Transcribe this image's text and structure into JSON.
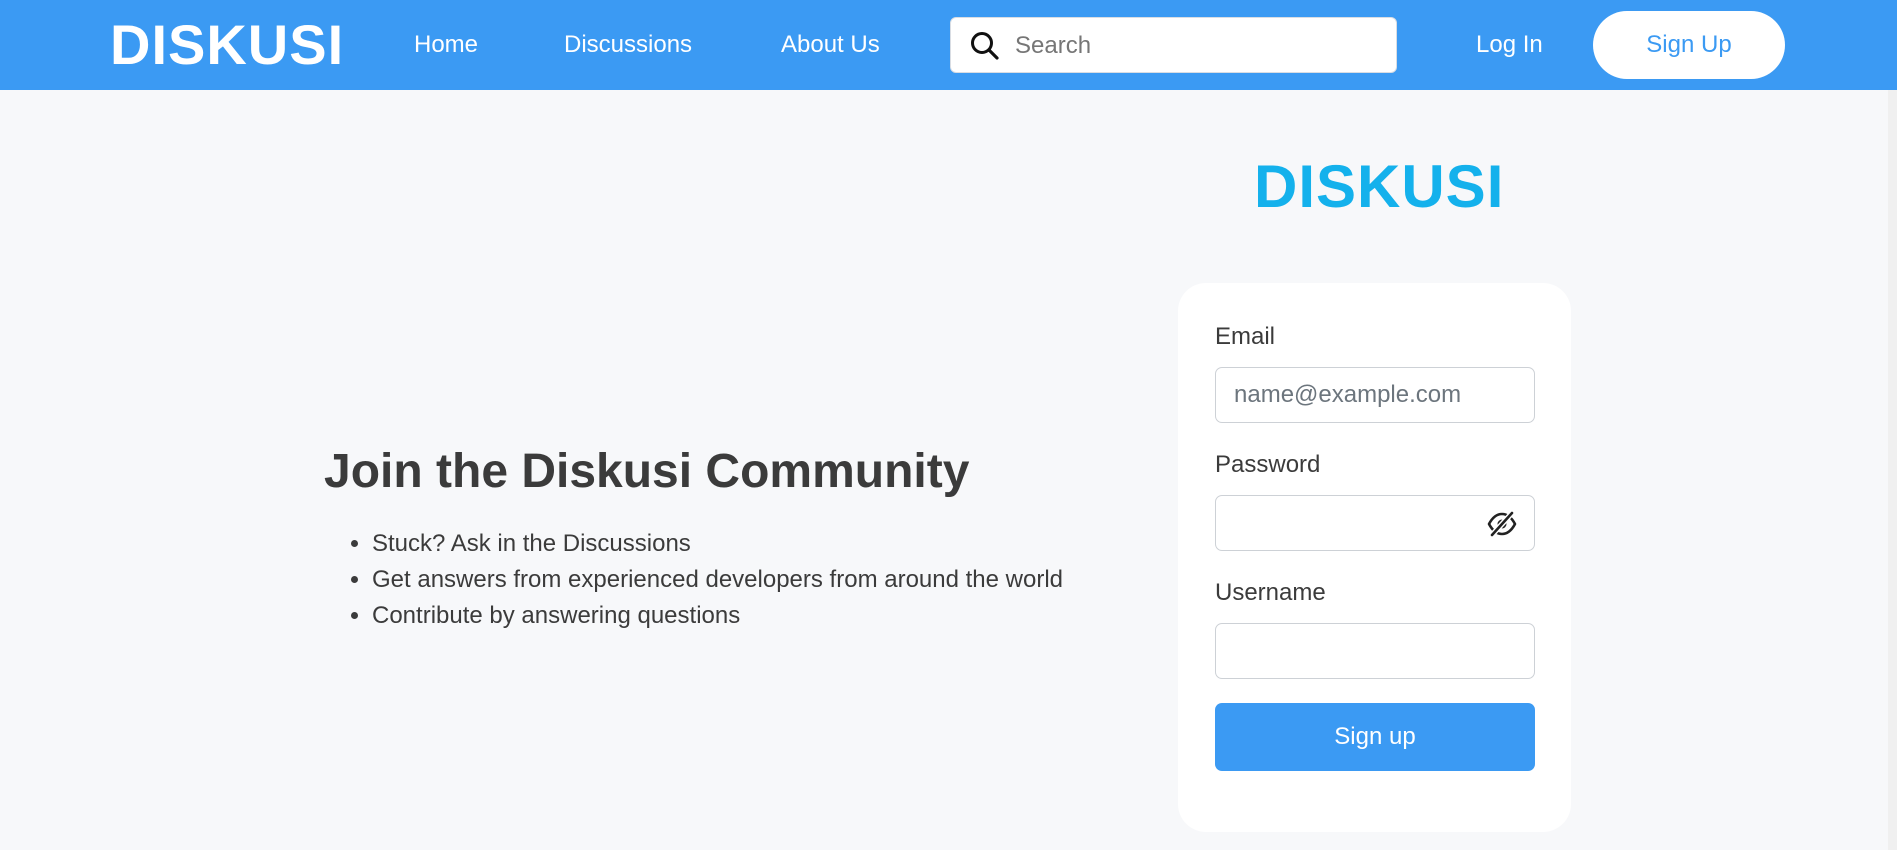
{
  "navbar": {
    "brand": "DISKUSI",
    "links": {
      "home": "Home",
      "discussions": "Discussions",
      "about": "About Us"
    },
    "search": {
      "placeholder": "Search",
      "value": ""
    },
    "login_label": "Log In",
    "signup_label": "Sign Up",
    "colors": {
      "background": "#3b9af3",
      "text": "#ffffff"
    }
  },
  "hero": {
    "title": "Join the Diskusi Community",
    "bullets": [
      "Stuck? Ask in the Discussions",
      "Get answers from experienced developers from around the world",
      "Contribute by answering questions"
    ]
  },
  "signup_form": {
    "brand": "DISKUSI",
    "brand_color": "#14b1ec",
    "email": {
      "label": "Email",
      "placeholder": "name@example.com",
      "value": ""
    },
    "password": {
      "label": "Password",
      "value": "",
      "toggle_icon": "eye-slash-icon"
    },
    "username": {
      "label": "Username",
      "value": ""
    },
    "submit_label": "Sign up",
    "submit_color": "#3b9af3"
  }
}
